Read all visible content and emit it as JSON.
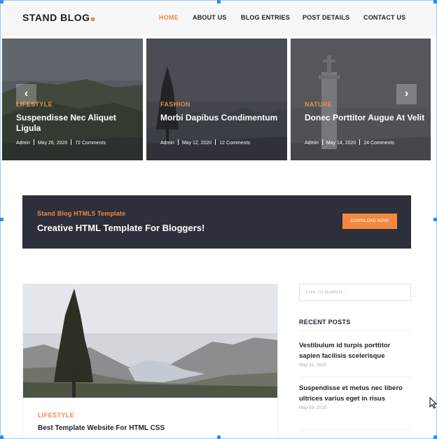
{
  "header": {
    "logo": "STAND BLOG",
    "nav": [
      {
        "label": "HOME",
        "active": true
      },
      {
        "label": "ABOUT US",
        "active": false
      },
      {
        "label": "BLOG ENTRIES",
        "active": false
      },
      {
        "label": "POST DETAILS",
        "active": false
      },
      {
        "label": "CONTACT US",
        "active": false
      }
    ]
  },
  "slider": {
    "prev_icon": "chevron-left-icon",
    "prev_glyph": "‹",
    "next_icon": "chevron-right-icon",
    "next_glyph": "›",
    "slides": [
      {
        "category": "LIFESTYLE",
        "title": "Suspendisse Nec Aliquet Ligula",
        "author": "Admin",
        "date": "May 26, 2020",
        "comments": "72 Comments"
      },
      {
        "category": "FASHION",
        "title": "Morbi Dapibus Condimentum",
        "author": "Admin",
        "date": "May 12, 2020",
        "comments": "12 Comments"
      },
      {
        "category": "NATURE",
        "title": "Donec Porttitor Augue At Velit",
        "author": "Admin",
        "date": "May 14, 2020",
        "comments": "24 Comments"
      }
    ]
  },
  "banner": {
    "subtitle": "Stand Blog HTML5 Template",
    "title": "Creative HTML Template For Bloggers!",
    "button": "DOWNLOAD NOW!"
  },
  "main_post": {
    "category": "LIFESTYLE",
    "title": "Best Template Website For HTML CSS"
  },
  "sidebar": {
    "search_placeholder": "TYPE TO SEARCH...",
    "recent_heading": "RECENT POSTS",
    "recent_posts": [
      {
        "title": "Vestibulum id turpis porttitor sapien facilisis scelerisque",
        "date": "May 31, 2020"
      },
      {
        "title": "Suspendisse et metus nec libero ultrices varius eget in risus",
        "date": "May 28, 2020"
      }
    ]
  },
  "colors": {
    "accent": "#f48840",
    "dark": "#20232e",
    "banner_bg": "#2d2f3a",
    "header_bg": "#f7f7f7"
  }
}
